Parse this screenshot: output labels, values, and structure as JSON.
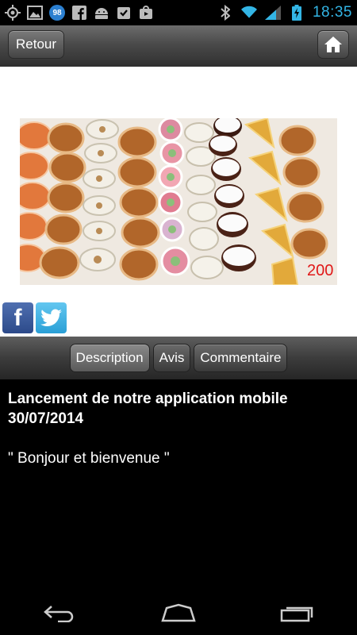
{
  "status_bar": {
    "notification_count": "98",
    "time": "18:35",
    "icons": [
      "gps-icon",
      "image-icon",
      "notification-badge",
      "facebook-icon",
      "android-icon",
      "task-check-icon",
      "store-icon",
      "bluetooth-icon",
      "wifi-icon",
      "signal-icon",
      "battery-icon"
    ],
    "time_color": "#33b5e5"
  },
  "topbar": {
    "back_label": "Retour",
    "home_icon": "home-icon"
  },
  "content": {
    "image": "pastries-photo",
    "image_caption": "200",
    "share": [
      "facebook-share-icon",
      "twitter-share-icon"
    ]
  },
  "tabs": [
    {
      "label": "Description",
      "active": true
    },
    {
      "label": "Avis",
      "active": false
    },
    {
      "label": "Commentaire",
      "active": false
    }
  ],
  "article": {
    "title": "Lancement de notre application mobile",
    "date": "30/07/2014",
    "body": "\" Bonjour et bienvenue \""
  },
  "navbar": {
    "buttons": [
      "back-icon",
      "home-nav-icon",
      "recent-apps-icon"
    ]
  }
}
